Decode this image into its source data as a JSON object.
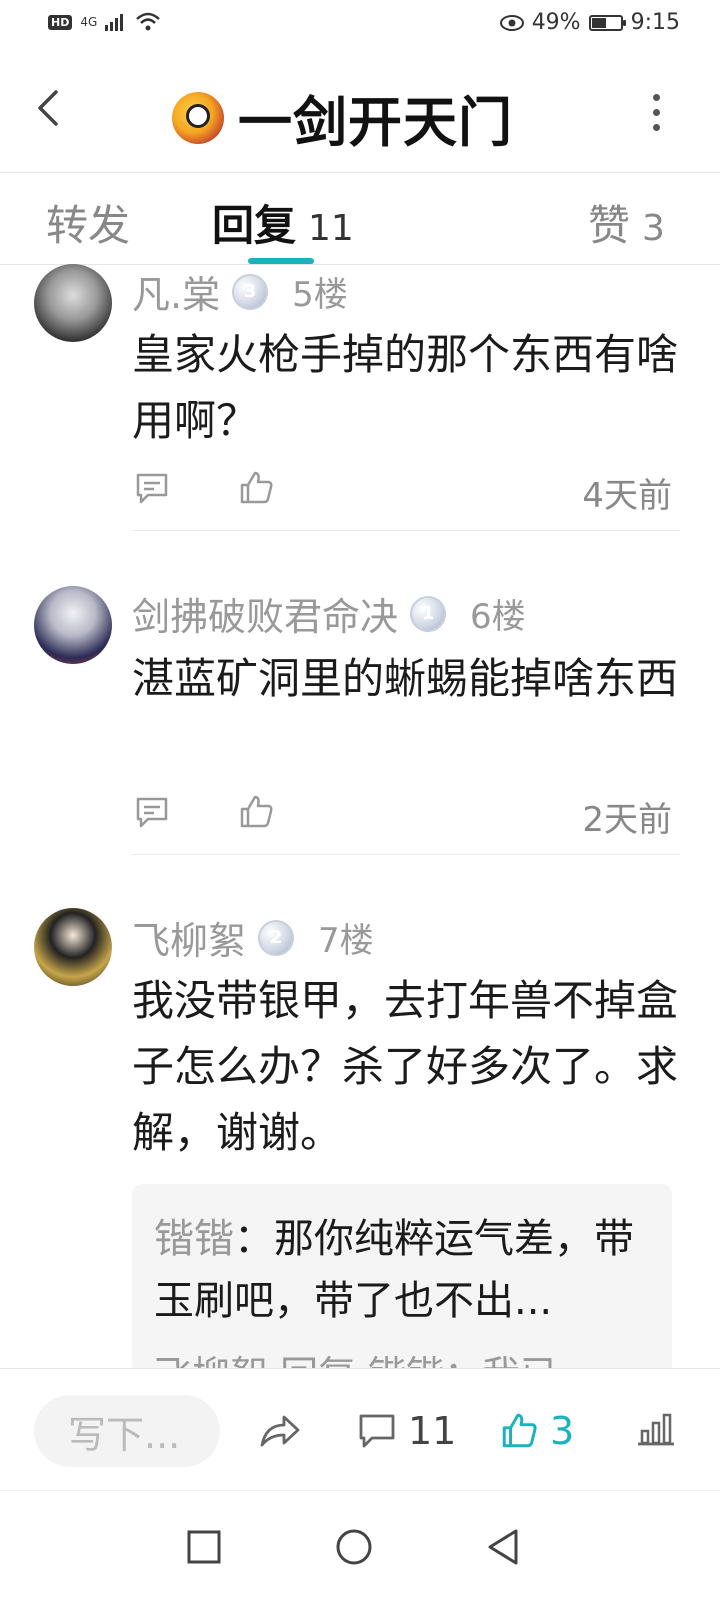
{
  "status_bar": {
    "hd": "HD",
    "network": "4G",
    "battery_percent": "49%",
    "battery_level": 0.49,
    "time": "9:15"
  },
  "header": {
    "title": "一剑开天门",
    "icons": [
      "back-arrow-icon",
      "forum-avatar",
      "more-dots-icon"
    ]
  },
  "tabs": {
    "repost_label": "转发",
    "reply_label": "回复",
    "reply_count": "11",
    "like_label": "赞",
    "like_count": "3",
    "accent_color": "#1ab2c1"
  },
  "replies": [
    {
      "username": "凡.棠",
      "level": "3",
      "floor": "5楼",
      "content": "皇家火枪手掉的那个东西有啥用啊？",
      "time": "4天前"
    },
    {
      "username": "剑拂破败君命决",
      "level": "1",
      "floor": "6楼",
      "content": "湛蓝矿洞里的蜥蜴能掉啥东西",
      "time": "2天前"
    },
    {
      "username": "飞柳絮",
      "level": "2",
      "floor": "7楼",
      "content": "我没带银甲，去打年兽不掉盒子怎么办？杀了好多次了。求解，谢谢。",
      "nested": {
        "name": "锴锴",
        "text": "：那你纯粹运气差，带玉刷吧，带了也不出...",
        "more_line": "飞柳絮 回复 锴锴：我已..."
      }
    }
  ],
  "bottom_bar": {
    "write_placeholder": "写下...",
    "comment_count": "11",
    "like_count": "3"
  }
}
